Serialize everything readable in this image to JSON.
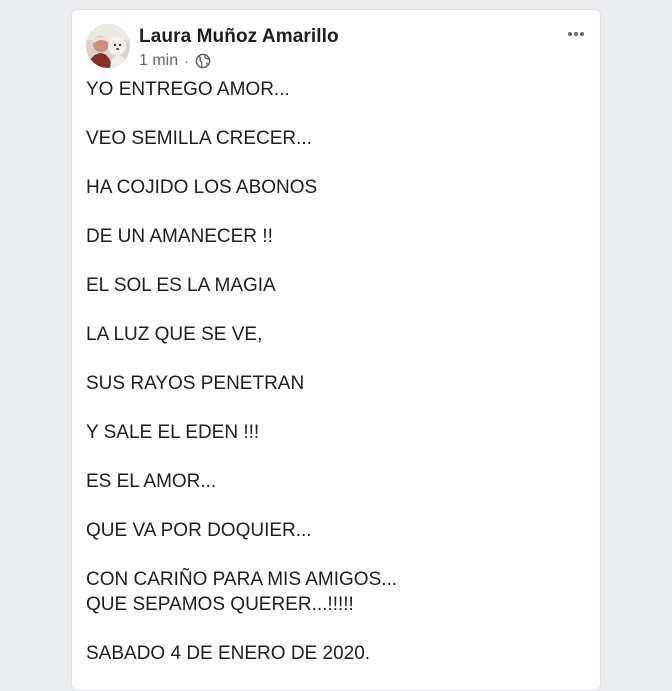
{
  "post": {
    "author": "Laura Muñoz Amarillo",
    "timestamp": "1 min",
    "separator": "·",
    "audience_icon": "globe-icon",
    "more_icon": "more-options-icon",
    "lines": [
      "YO ENTREGO AMOR...",
      "VEO SEMILLA CRECER...",
      "HA COJIDO LOS ABONOS",
      "DE UN AMANECER !!",
      "EL SOL ES LA MAGIA",
      "LA LUZ QUE SE VE,",
      "SUS RAYOS PENETRAN",
      "Y SALE EL EDEN !!!",
      "ES EL AMOR...",
      "QUE VA POR DOQUIER...",
      "CON CARIÑO PARA MIS AMIGOS...",
      "QUE SEPAMOS QUERER...!!!!!",
      "SABADO 4 DE ENERO DE 2020."
    ]
  },
  "colors": {
    "page_background": "#e9ebee",
    "card_background": "#ffffff",
    "text_primary": "#1c1e21",
    "text_secondary": "#606770"
  }
}
